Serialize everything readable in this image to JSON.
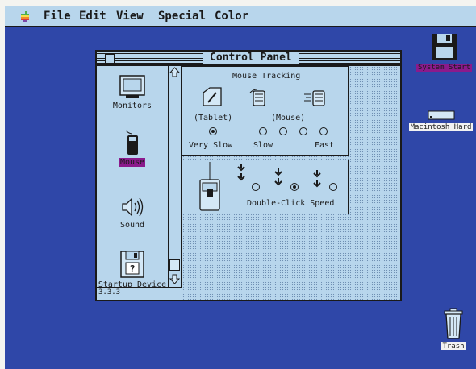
{
  "menubar": {
    "apple_icon": "apple-icon",
    "items": [
      "File",
      "Edit",
      "View",
      "Special",
      "Color"
    ]
  },
  "window": {
    "title": "Control Panel",
    "version": "3.3.3",
    "icons": [
      {
        "label": "Monitors",
        "icon": "monitor-icon"
      },
      {
        "label": "Mouse",
        "icon": "mouse-icon",
        "selected": true
      },
      {
        "label": "Sound",
        "icon": "speaker-icon"
      },
      {
        "label": "Startup Device",
        "icon": "disk-icon"
      }
    ],
    "mouse_tracking": {
      "title": "Mouse Tracking",
      "tablet_label": "(Tablet)",
      "mouse_label": "(Mouse)",
      "very_slow_label": "Very Slow",
      "slow_label": "Slow",
      "fast_label": "Fast",
      "selected_option": "Very Slow"
    },
    "double_click": {
      "label": "Double-Click Speed",
      "selected_index": 1
    }
  },
  "desktop": {
    "icons": [
      {
        "label": "System Start",
        "icon": "floppy-disk-icon",
        "selected": true
      },
      {
        "label": "Macintosh Hard",
        "icon": "hard-disk-icon",
        "selected": false
      },
      {
        "label": "Trash",
        "icon": "trash-icon",
        "selected": false
      }
    ]
  },
  "colors": {
    "desktop": "#2f47a8",
    "window": "#b8d6ec",
    "selection": "#8b1a8c"
  }
}
